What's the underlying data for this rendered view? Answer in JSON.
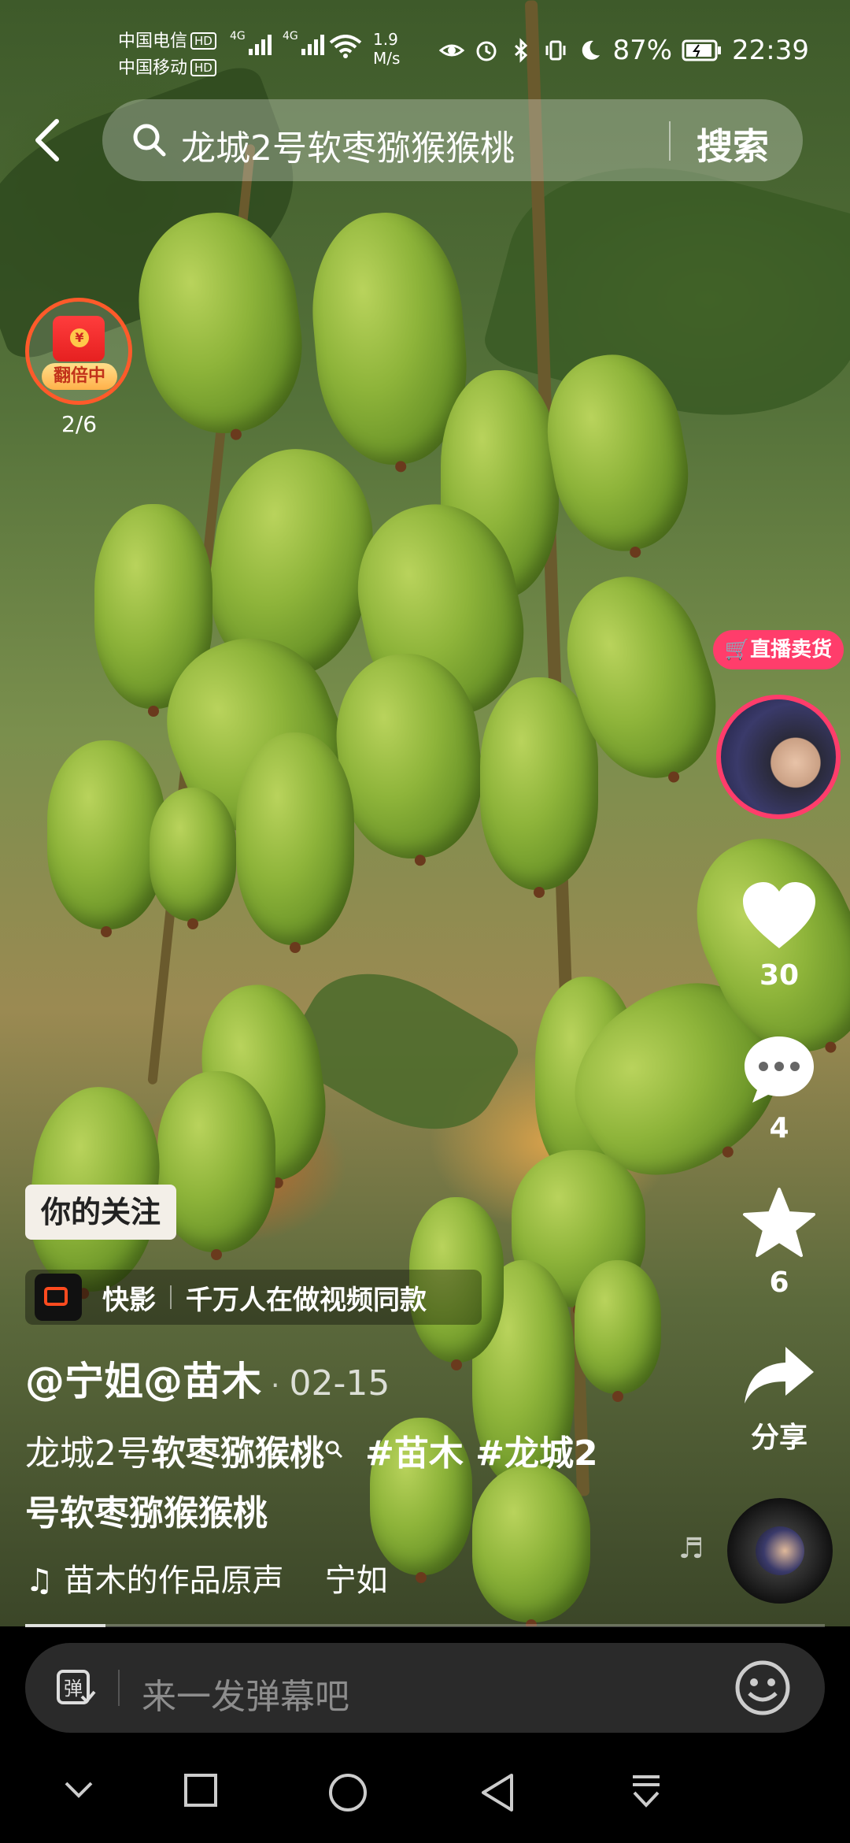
{
  "status_bar": {
    "carrier1": "中国电信",
    "carrier2": "中国移动",
    "hd": "HD",
    "network": "4G",
    "speed_value": "1.9",
    "speed_unit": "M/s",
    "battery": "87%",
    "time": "22:39"
  },
  "search": {
    "query": "龙城2号软枣猕猴猴桃",
    "button": "搜索"
  },
  "red_packet": {
    "badge": "翻倍中",
    "progress": "2/6"
  },
  "live": {
    "tag": "直播卖货"
  },
  "actions": {
    "likes": "30",
    "comments": "4",
    "favorites": "6",
    "share": "分享"
  },
  "video": {
    "follow_label": "你的关注",
    "app_name": "快影",
    "app_slogan": "千万人在做视频同款",
    "author": "@宁姐@苗木",
    "date_sep": "·",
    "date": "02-15",
    "caption_plain": "龙城2号",
    "caption_bold": "软枣猕猴桃",
    "caption_tags": "#苗木 #龙城2号软枣猕猴猴桃",
    "sound_title": "苗木的作品原声",
    "sound_owner": "宁如",
    "progress": 0.1
  },
  "danmaku": {
    "placeholder": "来一发弹幕吧",
    "icon_text": "弹"
  },
  "colors": {
    "accent_pink": "#ff3d6b",
    "packet_red": "#e62020",
    "follow_bg": "#f3efe8"
  }
}
